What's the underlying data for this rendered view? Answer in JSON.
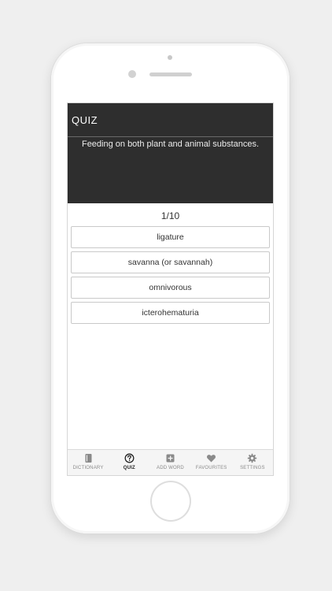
{
  "header": {
    "title": "QUIZ",
    "question": "Feeding on both plant and animal substances."
  },
  "quiz": {
    "progress": "1/10",
    "options": [
      {
        "label": "ligature"
      },
      {
        "label": "savanna (or savannah)"
      },
      {
        "label": "omnivorous"
      },
      {
        "label": "icterohematuria"
      }
    ]
  },
  "tabs": [
    {
      "label": "DICTIONARY",
      "icon": "book-icon",
      "active": false
    },
    {
      "label": "QUIZ",
      "icon": "question-circle-icon",
      "active": true
    },
    {
      "label": "ADD WORD",
      "icon": "plus-square-icon",
      "active": false
    },
    {
      "label": "FAVOURITES",
      "icon": "heart-icon",
      "active": false
    },
    {
      "label": "SETTINGS",
      "icon": "gear-icon",
      "active": false
    }
  ],
  "colors": {
    "header_bg": "#2e2e2e",
    "tab_inactive": "#8a8a8a",
    "tab_active": "#222222"
  }
}
